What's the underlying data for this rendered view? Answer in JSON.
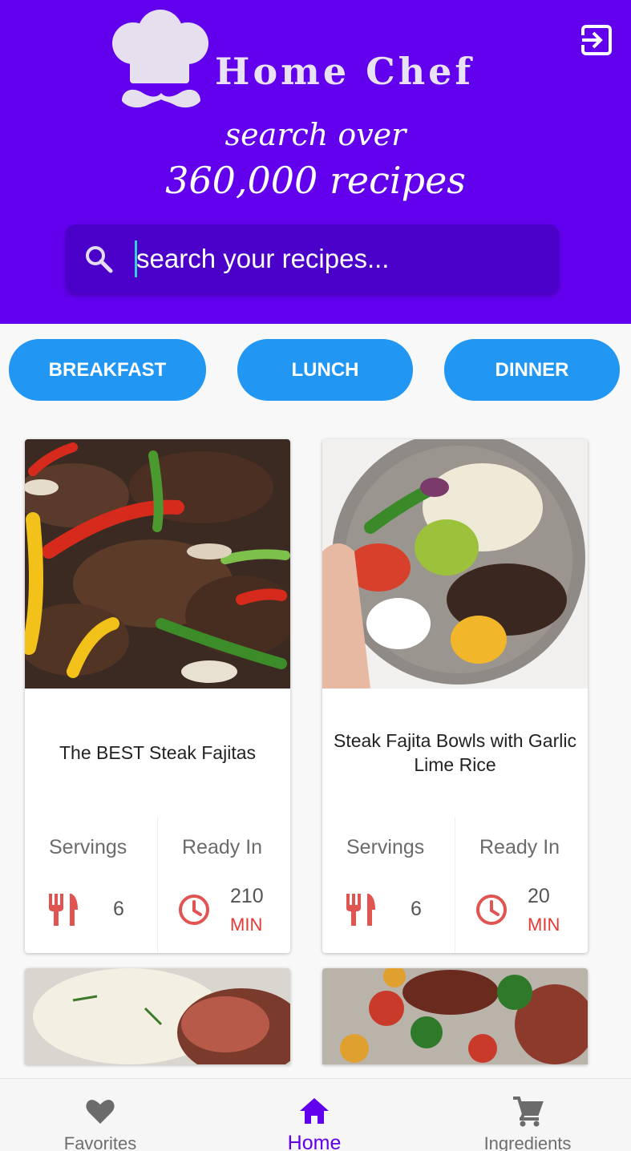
{
  "header": {
    "app_title": "Home Chef",
    "tagline_line1": "search over",
    "tagline_line2": "360,000 recipes",
    "background_color": "#6200ee",
    "logout_icon": "logout-icon",
    "logo_icon": "chef-hat-mustache-icon"
  },
  "search": {
    "placeholder": "search your recipes...",
    "value": "",
    "icon": "search-icon"
  },
  "categories": [
    {
      "label": "BREAKFAST"
    },
    {
      "label": "LUNCH"
    },
    {
      "label": "DINNER"
    }
  ],
  "accent_color": "#2196f3",
  "recipes": [
    {
      "title": "The BEST Steak Fajitas",
      "servings_label": "Servings",
      "servings": "6",
      "ready_label": "Ready In",
      "ready_time": "210",
      "ready_unit": "MIN"
    },
    {
      "title": "Steak Fajita Bowls with Garlic Lime Rice",
      "servings_label": "Servings",
      "servings": "6",
      "ready_label": "Ready In",
      "ready_time": "20",
      "ready_unit": "MIN"
    }
  ],
  "bottom_nav": [
    {
      "label": "Favorites",
      "icon": "heart-icon"
    },
    {
      "label": "Home",
      "icon": "home-icon",
      "active": true
    },
    {
      "label": "Ingredients",
      "icon": "cart-icon"
    }
  ]
}
